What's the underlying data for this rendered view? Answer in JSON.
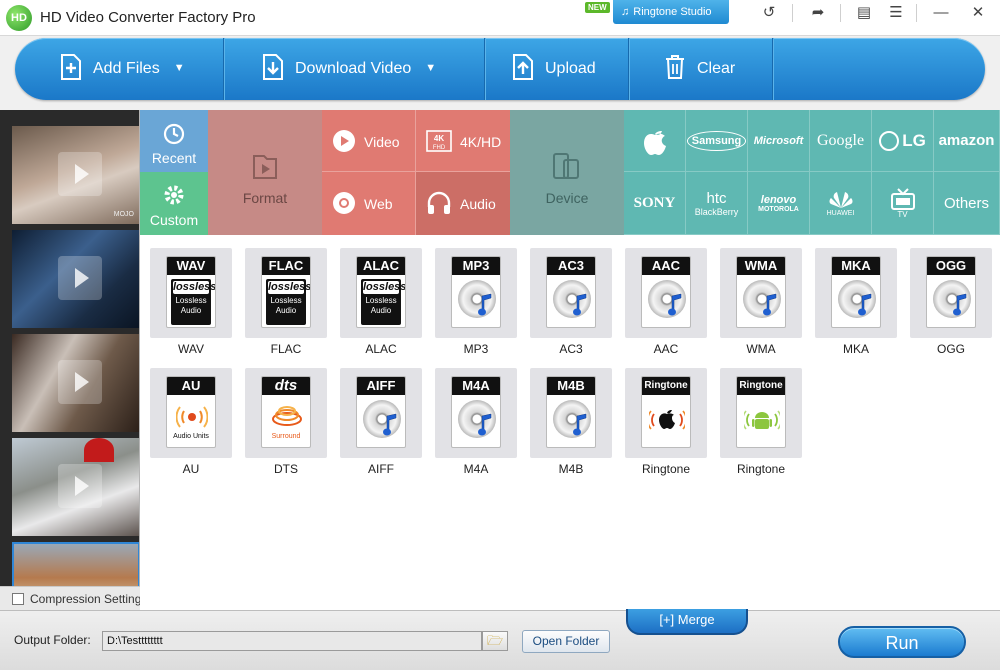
{
  "window": {
    "title": "HD Video Converter Factory Pro",
    "logo_text": "HD",
    "new_badge": "NEW",
    "ringtone_studio": "Ringtone Studio"
  },
  "toolbar": {
    "add_files": "Add Files",
    "download_video": "Download Video",
    "upload": "Upload",
    "clear": "Clear"
  },
  "categories": {
    "recent": "Recent",
    "custom": "Custom",
    "format": "Format",
    "video": "Video",
    "hd": "4K/HD",
    "web": "Web",
    "audio": "Audio",
    "device": "Device"
  },
  "brands": [
    "Samsung",
    "Microsoft",
    "Google",
    "LG",
    "amazon",
    "SONY",
    "htc",
    "lenovo",
    "HUAWEI",
    "TV",
    "Others"
  ],
  "brand_extra": {
    "htc_sub": "BlackBerry",
    "lenovo_sub": "MOTOROLA",
    "huawei": "HUAWEI",
    "tv": "TV"
  },
  "formats": [
    {
      "name": "WAV",
      "label": "WAV",
      "kind": "lossless"
    },
    {
      "name": "FLAC",
      "label": "FLAC",
      "kind": "lossless"
    },
    {
      "name": "ALAC",
      "label": "ALAC",
      "kind": "lossless"
    },
    {
      "name": "MP3",
      "label": "MP3",
      "kind": "disc"
    },
    {
      "name": "AC3",
      "label": "AC3",
      "kind": "disc"
    },
    {
      "name": "AAC",
      "label": "AAC",
      "kind": "disc"
    },
    {
      "name": "WMA",
      "label": "WMA",
      "kind": "disc"
    },
    {
      "name": "MKA",
      "label": "MKA",
      "kind": "disc"
    },
    {
      "name": "OGG",
      "label": "OGG",
      "kind": "disc"
    },
    {
      "name": "AU",
      "label": "AU",
      "kind": "au"
    },
    {
      "name": "dts",
      "label": "DTS",
      "kind": "dts"
    },
    {
      "name": "AIFF",
      "label": "AIFF",
      "kind": "disc"
    },
    {
      "name": "M4A",
      "label": "M4A",
      "kind": "disc"
    },
    {
      "name": "M4B",
      "label": "M4B",
      "kind": "disc"
    },
    {
      "name": "Ringtone",
      "label": "Ringtone",
      "kind": "ring-apple"
    },
    {
      "name": "Ringtone",
      "label": "Ringtone",
      "kind": "ring-android"
    }
  ],
  "card_text": {
    "lossless_word": "lossless",
    "lossless_sub": "Lossless Audio",
    "au_sub": "Audio Units",
    "dts_sub": "Surround"
  },
  "thumbnails": [
    {
      "watermark": "MOJO"
    },
    {
      "watermark": ""
    },
    {
      "watermark": ""
    },
    {
      "watermark": ""
    },
    {
      "watermark": ""
    }
  ],
  "compression_label": "Compression Settings",
  "bottom": {
    "output_folder_label": "Output Folder:",
    "output_folder_value": "D:\\Testttttttt",
    "open_folder": "Open Folder",
    "merge": "Merge",
    "merge_icon": "[+]",
    "run": "Run"
  },
  "colors": {
    "toolbar_blue": "#1b78c8",
    "recent_blue": "#6aa6d6",
    "custom_green": "#5dc48f",
    "format_tile": "#c68a86",
    "video_red": "#e07a72",
    "audio_selected": "#cc6e66",
    "device_teal": "#7aa6a2",
    "brand_teal": "#5fb8b2"
  }
}
